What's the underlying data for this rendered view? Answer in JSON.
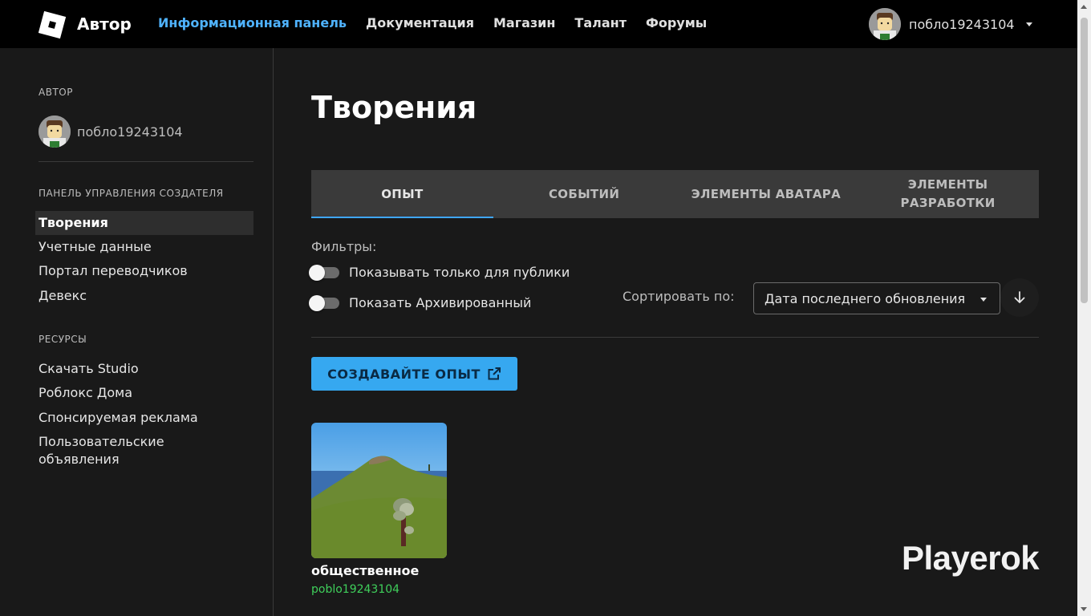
{
  "topnav": {
    "brand": "Автор",
    "links": [
      {
        "label": "Информационная панель",
        "active": true
      },
      {
        "label": "Документация"
      },
      {
        "label": "Магазин"
      },
      {
        "label": "Талант"
      },
      {
        "label": "Форумы"
      }
    ],
    "username": "побло19243104"
  },
  "sidebar": {
    "section_author": "АВТОР",
    "username": "побло19243104",
    "section_dashboard": "ПАНЕЛЬ УПРАВЛЕНИЯ СОЗДАТЕЛЯ",
    "dashboard_items": [
      {
        "label": "Творения",
        "active": true
      },
      {
        "label": "Учетные данные"
      },
      {
        "label": "Портал переводчиков"
      },
      {
        "label": "Девекс"
      }
    ],
    "section_resources": "РЕСУРСЫ",
    "resource_items": [
      {
        "label": "Скачать Studio"
      },
      {
        "label": "Роблокс Дома"
      },
      {
        "label": "Спонсируемая реклама"
      },
      {
        "label": "Пользовательские объявления"
      }
    ]
  },
  "main": {
    "title": "Творения",
    "tabs": [
      {
        "label": "ОПЫТ",
        "active": true
      },
      {
        "label": "СОБЫТИЙ"
      },
      {
        "label": "ЭЛЕМЕНТЫ АВАТАРА"
      },
      {
        "label": "ЭЛЕМЕНТЫ РАЗРАБОТКИ"
      }
    ],
    "filters_label": "Фильтры:",
    "filter_public_only": {
      "label": "Показывать только для публики",
      "on": false
    },
    "filter_archived": {
      "label": "Показать Архивированный",
      "on": false
    },
    "sort_label": "Сортировать по:",
    "sort_value": "Дата последнего обновления",
    "sort_direction_icon": "arrow-down-icon",
    "create_button": "СОЗДАВАЙТЕ ОПЫТ",
    "experiences": [
      {
        "title": "общественное",
        "author": "poblo19243104"
      }
    ]
  },
  "watermark": "Playerok",
  "colors": {
    "accent": "#36a8f0",
    "active_nav": "#4fb3ff",
    "author_link": "#3fcf5b",
    "background": "#191919",
    "topbar": "#000000"
  }
}
